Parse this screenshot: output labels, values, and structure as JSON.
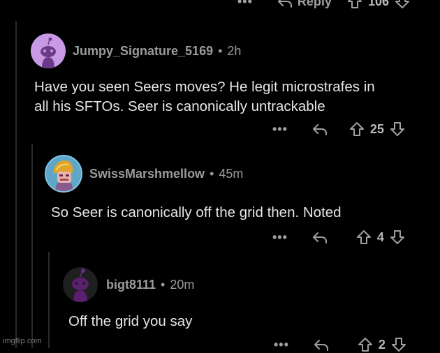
{
  "top_bar": {
    "more": "•••",
    "reply_label": "Reply",
    "votes": "106"
  },
  "comments": [
    {
      "username": "Jumpy_Signature_5169",
      "sep": "•",
      "time": "2h",
      "text_lines": [
        "Have you seen Seers moves? He legit microstrafes in",
        "all his SFTOs. Seer is canonically untrackable"
      ],
      "votes": "25",
      "more": "•••",
      "avatar_color": "#c89ae6"
    },
    {
      "username": "SwissMarshmellow",
      "sep": "•",
      "time": "45m",
      "text_lines": [
        "So Seer is canonically off the grid then. Noted"
      ],
      "votes": "4",
      "more": "•••",
      "avatar_color": "#5fa7c9"
    },
    {
      "username": "bigt8111",
      "sep": "•",
      "time": "20m",
      "text_lines": [
        "Off the grid you say"
      ],
      "votes": "2",
      "more": "•••",
      "avatar_color": "#5a1f6e"
    }
  ],
  "watermark": "imgflip.com"
}
